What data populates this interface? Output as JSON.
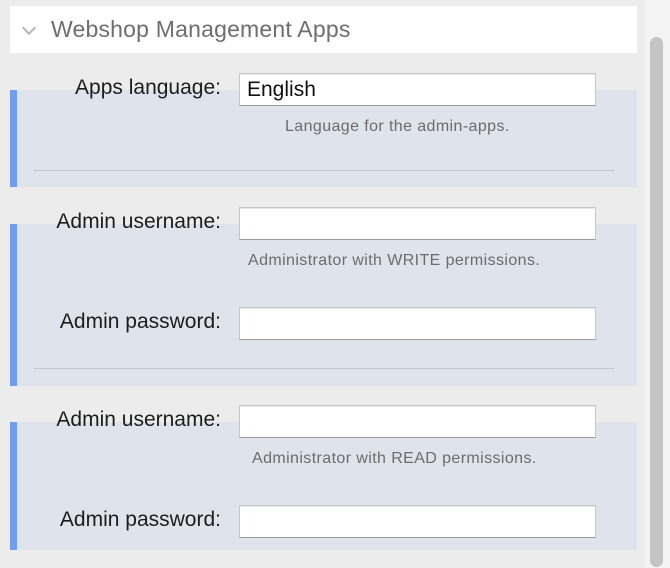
{
  "section": {
    "title": "Webshop Management Apps"
  },
  "language_group": {
    "label": "Apps language:",
    "value": "English",
    "hint": "Language for the admin-apps."
  },
  "write_admin": {
    "username_label": "Admin username:",
    "username_value": "",
    "hint": "Administrator with WRITE permissions.",
    "password_label": "Admin password:",
    "password_value": ""
  },
  "read_admin": {
    "username_label": "Admin username:",
    "username_value": "",
    "hint": "Administrator with READ permissions.",
    "password_label": "Admin password:",
    "password_value": ""
  },
  "colors": {
    "accent": "#6f9ef0",
    "band": "#dee3ec"
  }
}
